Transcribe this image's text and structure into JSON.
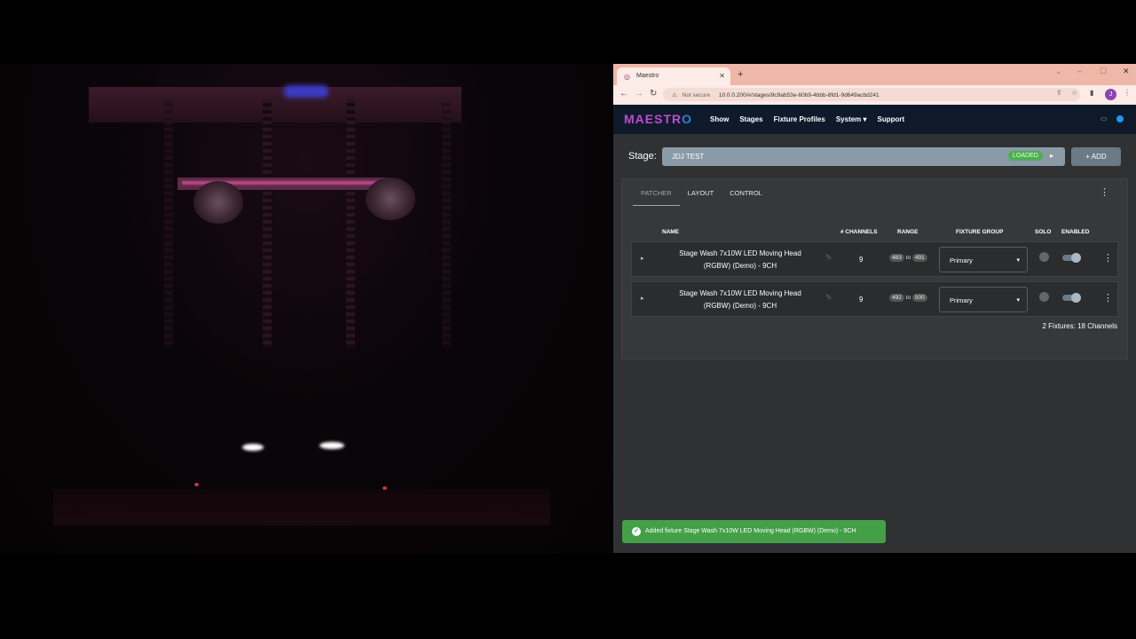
{
  "browser": {
    "tab_title": "Maestro",
    "security_label": "Not secure",
    "url": "10.0.0.200/#/stages/9c9ab53e-60b9-4bbb-8fd1-9d649acbd241",
    "avatar_letter": "J"
  },
  "app": {
    "logo_pre": "MAESTR",
    "logo_o": "O",
    "menu": [
      "Show",
      "Stages",
      "Fixture Profiles",
      "System ▾",
      "Support"
    ]
  },
  "stage": {
    "label": "Stage:",
    "name": "JDJ TEST",
    "status": "LOADED",
    "add_label": "+  ADD"
  },
  "tabs": [
    "PATCHER",
    "LAYOUT",
    "CONTROL"
  ],
  "table": {
    "headers": [
      "NAME",
      "# CHANNELS",
      "RANGE",
      "FIXTURE GROUP",
      "SOLO",
      "ENABLED"
    ],
    "rows": [
      {
        "name_line1": "Stage Wash 7x10W LED Moving Head",
        "name_line2": "(RGBW) (Demo) - 9CH",
        "channels": "9",
        "range_start": "483",
        "range_to": "to",
        "range_end": "491",
        "group": "Primary"
      },
      {
        "name_line1": "Stage Wash 7x10W LED Moving Head",
        "name_line2": "(RGBW) (Demo) - 9CH",
        "channels": "9",
        "range_start": "492",
        "range_to": "to",
        "range_end": "500",
        "group": "Primary"
      }
    ],
    "summary": "2 Fixtures: 18 Channels"
  },
  "toast": {
    "message": "Added fixture Stage Wash 7x10W LED Moving Head (RGBW) (Demo) - 9CH"
  },
  "colors": {
    "accent": "#c04ad0",
    "success": "#43a047",
    "loaded": "#4caf50"
  }
}
